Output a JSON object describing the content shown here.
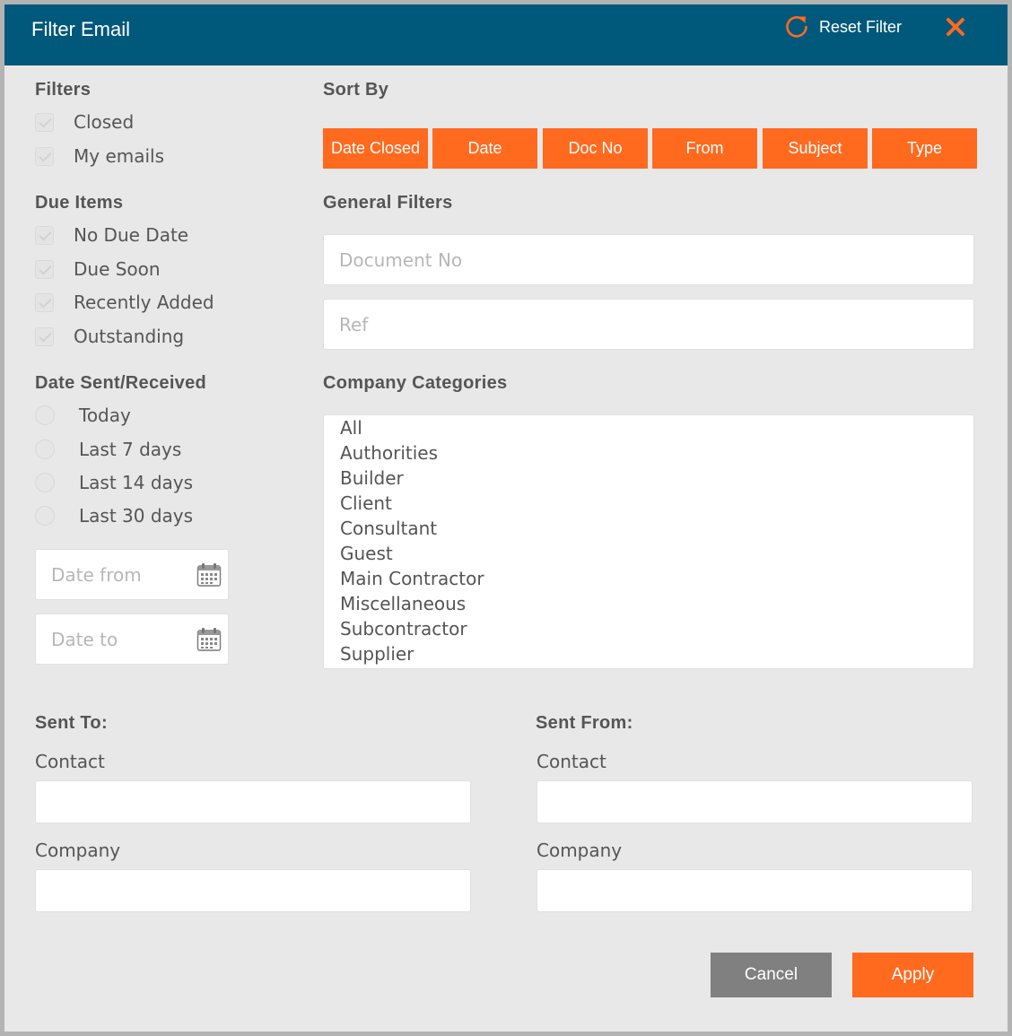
{
  "dialog": {
    "title": "Filter Email",
    "reset_label": "Reset Filter"
  },
  "colors": {
    "header": "#00587a",
    "accent": "#ff6a1f",
    "cancel": "#808080",
    "background": "#e8e8e8"
  },
  "filters": {
    "title": "Filters",
    "items": [
      {
        "label": "Closed",
        "checked": false
      },
      {
        "label": "My emails",
        "checked": false
      }
    ]
  },
  "due_items": {
    "title": "Due Items",
    "items": [
      {
        "label": "No Due Date",
        "checked": false
      },
      {
        "label": "Due Soon",
        "checked": false
      },
      {
        "label": "Recently Added",
        "checked": false
      },
      {
        "label": "Outstanding",
        "checked": false
      }
    ]
  },
  "date_sent": {
    "title": "Date Sent/Received",
    "options": [
      {
        "label": "Today",
        "selected": false
      },
      {
        "label": "Last 7 days",
        "selected": false
      },
      {
        "label": "Last 14 days",
        "selected": false
      },
      {
        "label": "Last 30 days",
        "selected": false
      }
    ],
    "date_from_placeholder": "Date from",
    "date_to_placeholder": "Date to"
  },
  "sort_by": {
    "title": "Sort By",
    "buttons": [
      "Date Closed",
      "Date",
      "Doc No",
      "From",
      "Subject",
      "Type"
    ]
  },
  "general_filters": {
    "title": "General Filters",
    "document_no_placeholder": "Document No",
    "ref_placeholder": "Ref"
  },
  "company_categories": {
    "title": "Company Categories",
    "items": [
      "All",
      "Authorities",
      "Builder",
      "Client",
      "Consultant",
      "Guest",
      "Main Contractor",
      "Miscellaneous",
      "Subcontractor",
      "Supplier"
    ]
  },
  "sent_to": {
    "title": "Sent To:",
    "contact_label": "Contact",
    "contact_value": "",
    "company_label": "Company",
    "company_value": ""
  },
  "sent_from": {
    "title": "Sent From:",
    "contact_label": "Contact",
    "contact_value": "",
    "company_label": "Company",
    "company_value": ""
  },
  "actions": {
    "cancel_label": "Cancel",
    "apply_label": "Apply"
  }
}
